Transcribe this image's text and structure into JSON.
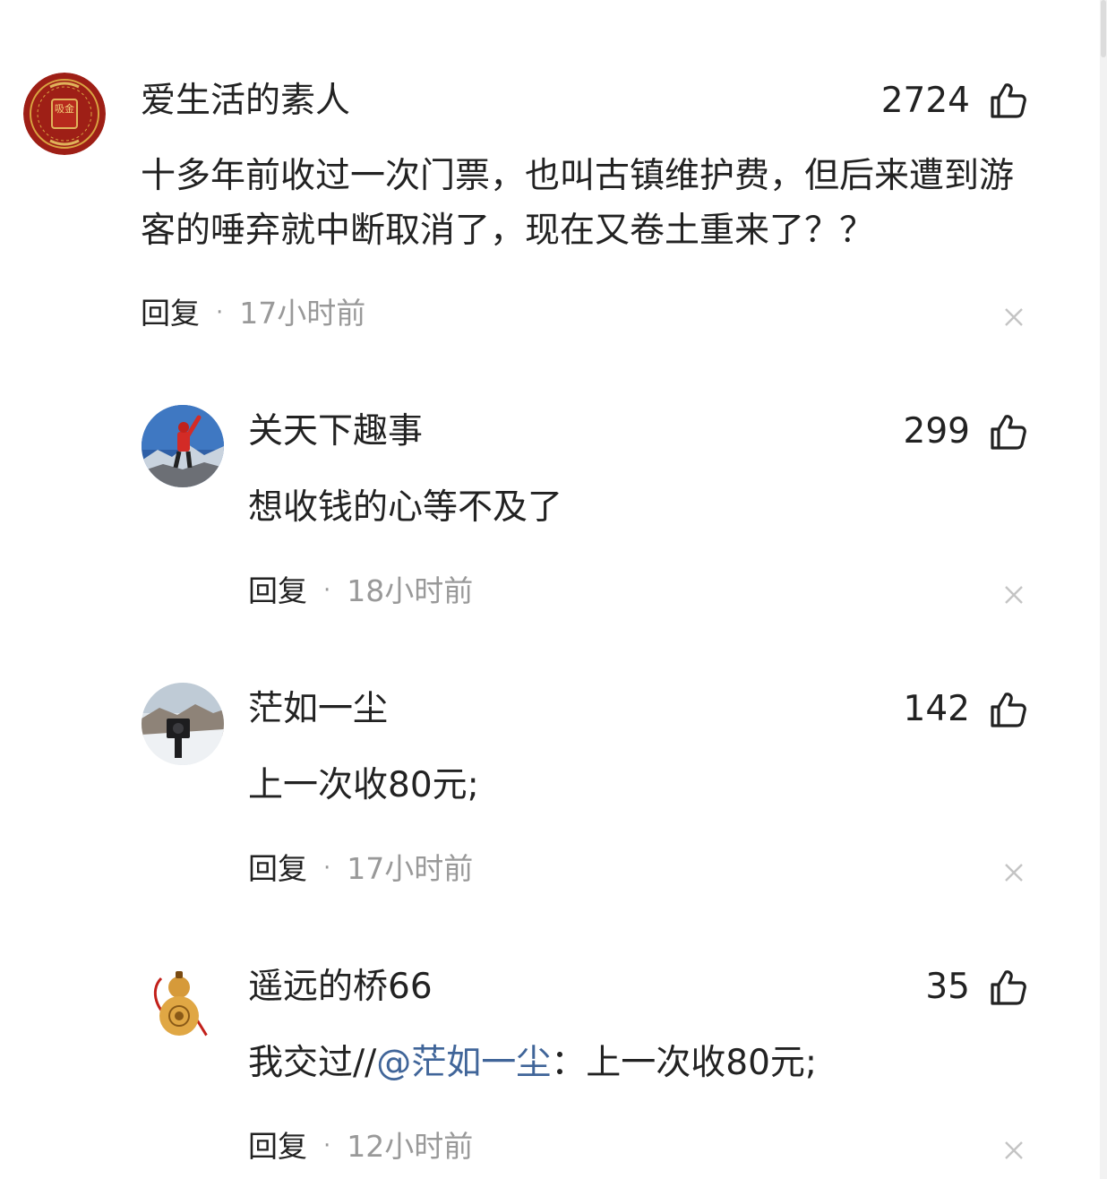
{
  "colors": {
    "text": "#222222",
    "meta": "#999999",
    "mention": "#406599",
    "icon": "#222222",
    "close": "#c4c4c4"
  },
  "comments": [
    {
      "avatar": "red-seal-avatar",
      "avatar_text": "吸金",
      "name": "爱生活的素人",
      "likes": "2724",
      "text": "十多年前收过一次门票，也叫古镇维护费，但后来遭到游客的唾弃就中断取消了，现在又卷土重来了？？",
      "reply_label": "回复",
      "dot": "·",
      "time": "17小时前"
    },
    {
      "avatar": "hiker-avatar",
      "name": "关天下趣事",
      "likes": "299",
      "text": "想收钱的心等不及了",
      "reply_label": "回复",
      "dot": "·",
      "time": "18小时前"
    },
    {
      "avatar": "camera-snow-avatar",
      "name": "茫如一尘",
      "likes": "142",
      "text": "上一次收80元;",
      "reply_label": "回复",
      "dot": "·",
      "time": "17小时前"
    },
    {
      "avatar": "gourd-avatar",
      "name": "遥远的桥66",
      "likes": "35",
      "text_prefix": "我交过//",
      "mention": "@茫如一尘",
      "text_suffix": "：上一次收80元;",
      "reply_label": "回复",
      "dot": "·",
      "time": "12小时前"
    }
  ]
}
